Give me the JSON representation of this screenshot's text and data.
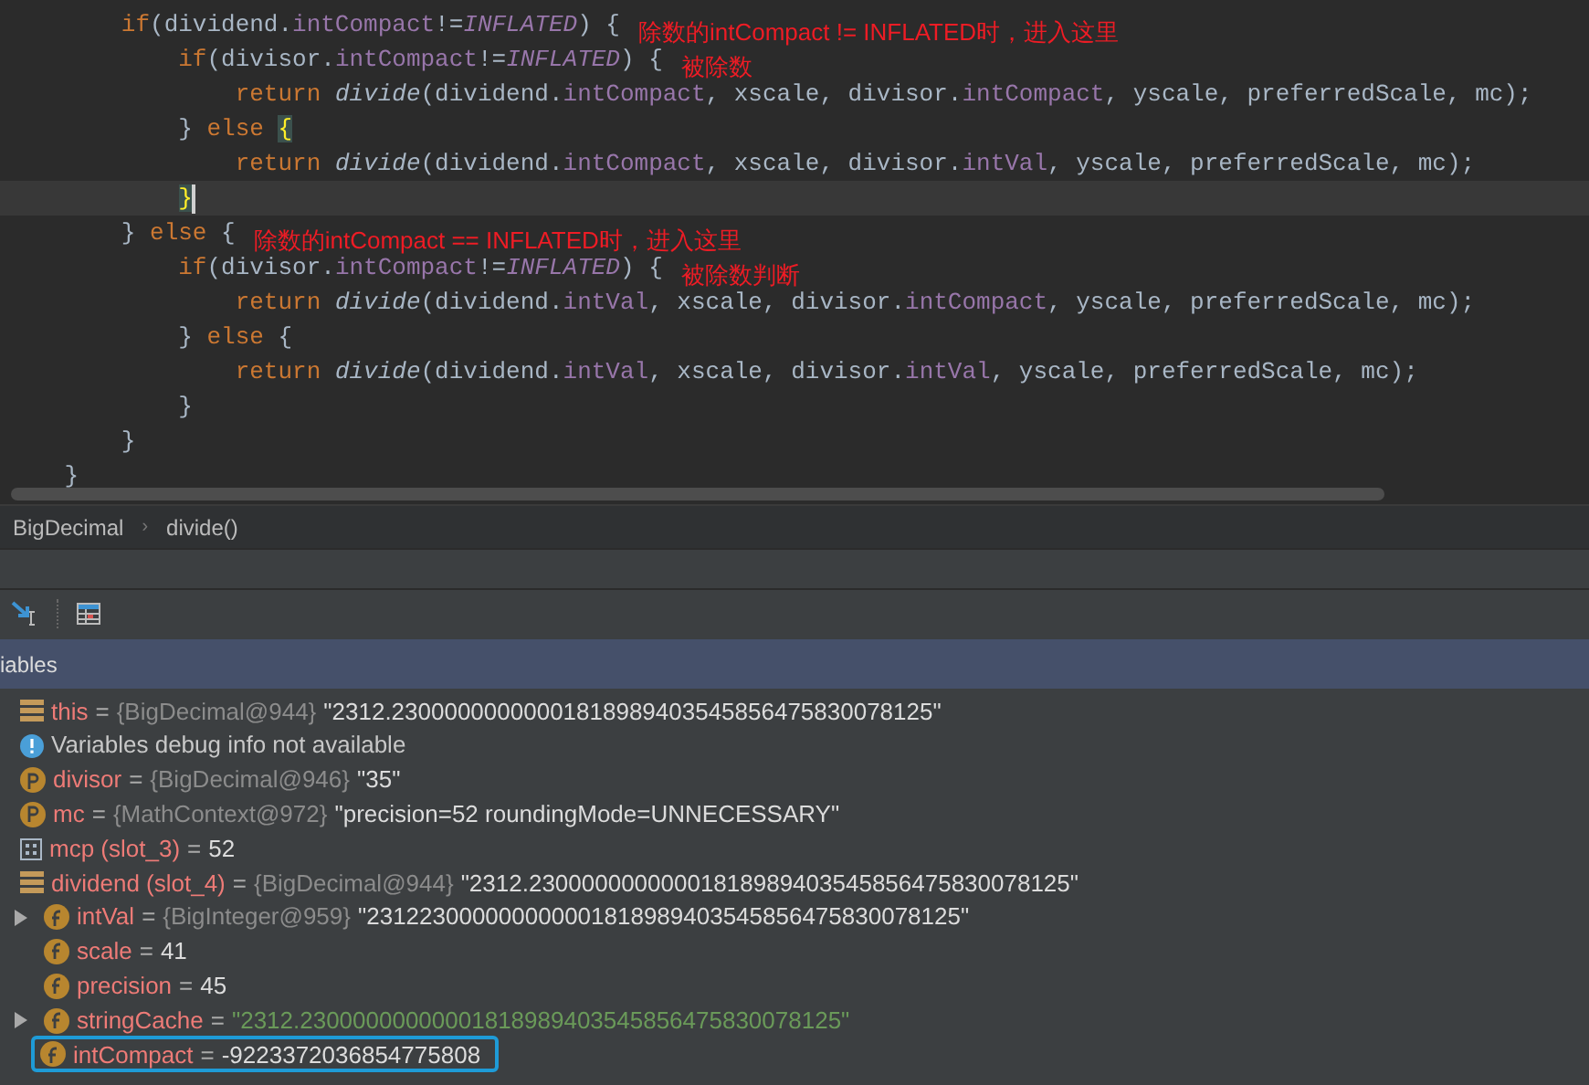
{
  "editor": {
    "lines": [
      {
        "current": false,
        "tokens": [
          {
            "kind": "kw",
            "text": "        if"
          },
          {
            "kind": "plain",
            "text": "(dividend."
          },
          {
            "kind": "field",
            "text": "intCompact"
          },
          {
            "kind": "plain",
            "text": "!="
          },
          {
            "kind": "const",
            "text": "INFLATED"
          },
          {
            "kind": "plain",
            "text": ") {"
          }
        ],
        "note": "除数的intCompact != INFLATED时，进入这里"
      },
      {
        "current": false,
        "tokens": [
          {
            "kind": "kw",
            "text": "            if"
          },
          {
            "kind": "plain",
            "text": "(divisor."
          },
          {
            "kind": "field",
            "text": "intCompact"
          },
          {
            "kind": "plain",
            "text": "!="
          },
          {
            "kind": "const",
            "text": "INFLATED"
          },
          {
            "kind": "plain",
            "text": ") {"
          }
        ],
        "note": "被除数"
      },
      {
        "current": false,
        "tokens": [
          {
            "kind": "kw",
            "text": "                return "
          },
          {
            "kind": "method",
            "text": "divide"
          },
          {
            "kind": "plain",
            "text": "(dividend."
          },
          {
            "kind": "field",
            "text": "intCompact"
          },
          {
            "kind": "plain",
            "text": ", xscale, divisor."
          },
          {
            "kind": "field",
            "text": "intCompact"
          },
          {
            "kind": "plain",
            "text": ", yscale, preferredScale, mc);"
          }
        ]
      },
      {
        "current": false,
        "tokens": [
          {
            "kind": "plain",
            "text": "            } "
          },
          {
            "kind": "kw",
            "text": "else "
          },
          {
            "kind": "brace",
            "text": "{"
          }
        ]
      },
      {
        "current": false,
        "tokens": [
          {
            "kind": "kw",
            "text": "                return "
          },
          {
            "kind": "method",
            "text": "divide"
          },
          {
            "kind": "plain",
            "text": "(dividend."
          },
          {
            "kind": "field",
            "text": "intCompact"
          },
          {
            "kind": "plain",
            "text": ", xscale, divisor."
          },
          {
            "kind": "field",
            "text": "intVal"
          },
          {
            "kind": "plain",
            "text": ", yscale, preferredScale, mc);"
          }
        ]
      },
      {
        "current": true,
        "tokens": [
          {
            "kind": "brace",
            "text": "            }"
          }
        ]
      },
      {
        "current": false,
        "tokens": [
          {
            "kind": "plain",
            "text": "        } "
          },
          {
            "kind": "kw",
            "text": "else "
          },
          {
            "kind": "plain",
            "text": "{"
          }
        ],
        "note": "除数的intCompact == INFLATED时，进入这里"
      },
      {
        "current": false,
        "tokens": [
          {
            "kind": "kw",
            "text": "            if"
          },
          {
            "kind": "plain",
            "text": "(divisor."
          },
          {
            "kind": "field",
            "text": "intCompact"
          },
          {
            "kind": "plain",
            "text": "!="
          },
          {
            "kind": "const",
            "text": "INFLATED"
          },
          {
            "kind": "plain",
            "text": ") {"
          }
        ],
        "note": "被除数判断"
      },
      {
        "current": false,
        "tokens": [
          {
            "kind": "kw",
            "text": "                return "
          },
          {
            "kind": "method",
            "text": "divide"
          },
          {
            "kind": "plain",
            "text": "(dividend."
          },
          {
            "kind": "field",
            "text": "intVal"
          },
          {
            "kind": "plain",
            "text": ", xscale, divisor."
          },
          {
            "kind": "field",
            "text": "intCompact"
          },
          {
            "kind": "plain",
            "text": ", yscale, preferredScale, mc);"
          }
        ]
      },
      {
        "current": false,
        "tokens": [
          {
            "kind": "plain",
            "text": "            } "
          },
          {
            "kind": "kw",
            "text": "else "
          },
          {
            "kind": "plain",
            "text": "{"
          }
        ]
      },
      {
        "current": false,
        "tokens": [
          {
            "kind": "kw",
            "text": "                return "
          },
          {
            "kind": "method",
            "text": "divide"
          },
          {
            "kind": "plain",
            "text": "(dividend."
          },
          {
            "kind": "field",
            "text": "intVal"
          },
          {
            "kind": "plain",
            "text": ", xscale, divisor."
          },
          {
            "kind": "field",
            "text": "intVal"
          },
          {
            "kind": "plain",
            "text": ", yscale, preferredScale, mc);"
          }
        ]
      },
      {
        "current": false,
        "tokens": [
          {
            "kind": "plain",
            "text": "            }"
          }
        ]
      },
      {
        "current": false,
        "tokens": [
          {
            "kind": "plain",
            "text": "        }"
          }
        ]
      },
      {
        "current": false,
        "tokens": [
          {
            "kind": "plain",
            "text": "    }"
          }
        ]
      }
    ]
  },
  "breadcrumb": {
    "items": [
      "BigDecimal",
      "divide()"
    ],
    "separator": "›"
  },
  "variables": {
    "title": "iables",
    "items": [
      {
        "kind": "object",
        "name": "this",
        "equals": "=",
        "type": "{BigDecimal@944}",
        "value": "\"2312.23000000000001818989403545856475830078125\"",
        "highlighted": false
      },
      {
        "kind": "info",
        "message": "Variables debug info not available",
        "highlighted": false
      },
      {
        "kind": "param",
        "name": "divisor",
        "equals": "=",
        "type": "{BigDecimal@946}",
        "value": "\"35\"",
        "highlighted": false
      },
      {
        "kind": "param",
        "name": "mc",
        "equals": "=",
        "type": "{MathContext@972}",
        "value": "\"precision=52 roundingMode=UNNECESSARY\"",
        "highlighted": false
      },
      {
        "kind": "primitive",
        "name": "mcp (slot_3)",
        "equals": "=",
        "value": "52",
        "highlighted": false
      },
      {
        "kind": "object",
        "name": "dividend (slot_4)",
        "equals": "=",
        "type": "{BigDecimal@944}",
        "value": "\"2312.23000000000001818989403545856475830078125\"",
        "highlighted": false,
        "children": [
          {
            "kind": "field",
            "name": "intVal",
            "equals": "=",
            "type": "{BigInteger@959}",
            "value": "\"231223000000000001818989403545856475830078125\"",
            "expanded": false,
            "highlighted": false
          },
          {
            "kind": "field",
            "name": "scale",
            "equals": "=",
            "value": "41",
            "highlighted": false
          },
          {
            "kind": "field",
            "name": "precision",
            "equals": "=",
            "value": "45",
            "highlighted": false
          },
          {
            "kind": "string_field",
            "name": "stringCache",
            "equals": "=",
            "value": "\"2312.23000000000001818989403545856475830078125\"",
            "expanded": false,
            "highlighted": false
          },
          {
            "kind": "field",
            "name": "intCompact",
            "equals": "=",
            "value": "-9223372036854775808",
            "highlighted": true
          }
        ]
      }
    ]
  }
}
